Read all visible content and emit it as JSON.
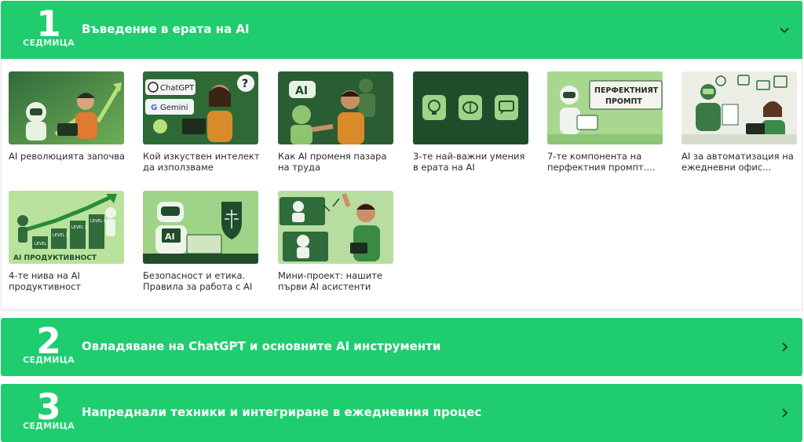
{
  "weeks": [
    {
      "number": "1",
      "label": "СЕДМИЦА",
      "title": "Въведение в ерата на AI",
      "expanded": true
    },
    {
      "number": "2",
      "label": "СЕДМИЦА",
      "title": "Овладяване на ChatGPT и основните AI инструменти",
      "expanded": false
    },
    {
      "number": "3",
      "label": "СЕДМИЦА",
      "title": "Напреднали техники и интегриране в ежедневния процес",
      "expanded": false
    }
  ],
  "lessons": [
    {
      "title": "AI революцията започва"
    },
    {
      "title": "Кой изкуствен интелект да използваме",
      "thumb_text": [
        "ChatGPT",
        "Gemini"
      ]
    },
    {
      "title": "Как AI променя пазара на труда",
      "thumb_text": [
        "AI"
      ]
    },
    {
      "title": "3-те най-важни умения в ерата на AI"
    },
    {
      "title": "7-те компонента на перфектния промпт....",
      "thumb_text": [
        "ПЕРФЕКТНИЯТ",
        "ПРОМПТ"
      ]
    },
    {
      "title": "AI за автоматизация на ежедневни офис..."
    },
    {
      "title": "4-те нива на AI продуктивност",
      "thumb_text": [
        "LEVEL",
        "LEVEL 2",
        "LEVEL 3",
        "LEVEL 4",
        "AI ПРОДУКТИВНОСТ"
      ]
    },
    {
      "title": "Безопасност и етика. Правила за работа с AI",
      "thumb_text": [
        "AI"
      ]
    },
    {
      "title": "Мини-проект: нашите първи AI асистенти"
    }
  ],
  "colors": {
    "accent": "#1fcd6f",
    "thumb_light": "#9fd387",
    "thumb_dark": "#1f4d2c"
  }
}
